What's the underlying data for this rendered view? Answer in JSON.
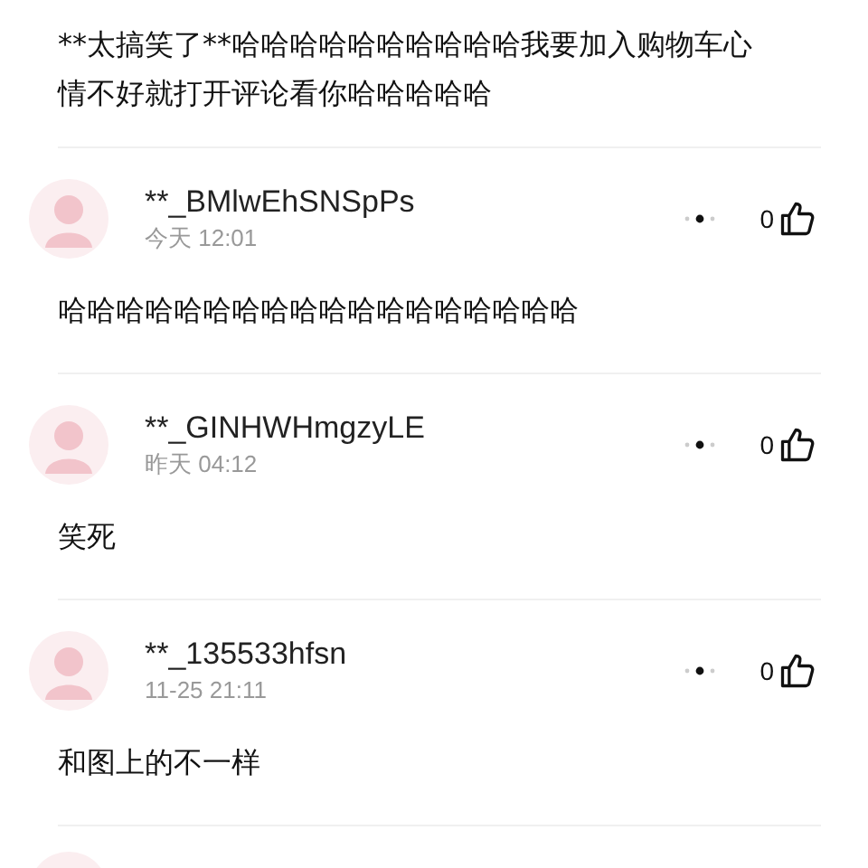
{
  "post": {
    "text": "**太搞笑了**哈哈哈哈哈哈哈哈哈哈我要加入购物车心情不好就打开评论看你哈哈哈哈哈"
  },
  "comments": [
    {
      "name": "**_BMlwEhSNSpPs",
      "time": "今天 12:01",
      "text": "哈哈哈哈哈哈哈哈哈哈哈哈哈哈哈哈哈哈",
      "likes": "0"
    },
    {
      "name": "**_GINHWHmgzyLE",
      "time": "昨天 04:12",
      "text": "笑死",
      "likes": "0"
    },
    {
      "name": "**_135533hfsn",
      "time": "11-25 21:11",
      "text": "和图上的不一样",
      "likes": "0"
    }
  ],
  "next_avatar_peek": true
}
